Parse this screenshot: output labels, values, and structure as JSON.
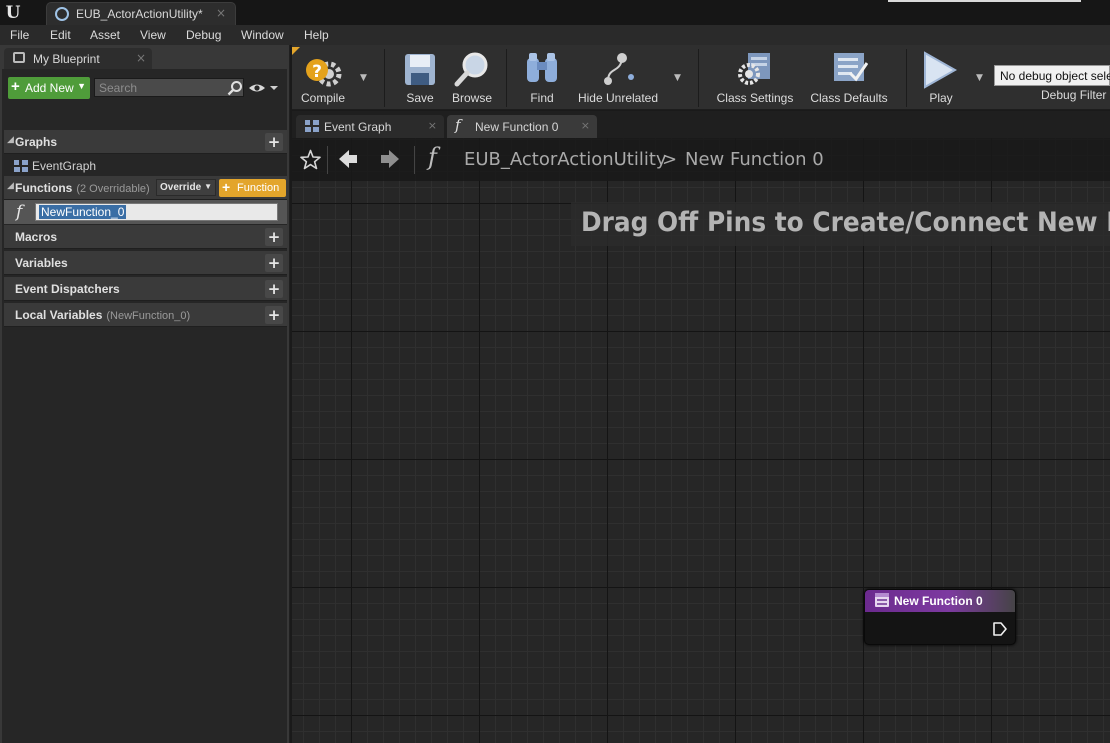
{
  "window": {
    "tab_title": "EUB_ActorActionUtility*",
    "tab_close": "×"
  },
  "menu": [
    "File",
    "Edit",
    "Asset",
    "View",
    "Debug",
    "Window",
    "Help"
  ],
  "left_panel": {
    "tab_label": "My Blueprint",
    "tab_close": "×",
    "add_new_label": "Add New",
    "search_placeholder": "Search",
    "sections": {
      "graphs": "Graphs",
      "graphs_item": "EventGraph",
      "functions": "Functions",
      "functions_sub": "(2 Overridable)",
      "override_label": "Override",
      "function_button_label": "Function",
      "function_item_name": "NewFunction_0",
      "macros": "Macros",
      "variables": "Variables",
      "event_dispatchers": "Event Dispatchers",
      "local_variables": "Local Variables",
      "local_variables_sub": "(NewFunction_0)"
    }
  },
  "toolbar": {
    "compile": "Compile",
    "save": "Save",
    "browse": "Browse",
    "find": "Find",
    "hide_unrelated": "Hide Unrelated",
    "class_settings": "Class Settings",
    "class_defaults": "Class Defaults",
    "play": "Play",
    "debug_object": "No debug object sele",
    "debug_filter": "Debug Filter"
  },
  "graph_tabs": [
    {
      "label": "Event Graph",
      "close": "×"
    },
    {
      "label": "New Function 0",
      "close": "×"
    }
  ],
  "graph": {
    "breadcrumb_blueprint": "EUB_ActorActionUtility",
    "breadcrumb_separator": ">",
    "breadcrumb_function": "New Function 0",
    "hint": "Drag Off Pins to Create/Connect New Nod",
    "node_title": "New Function 0"
  },
  "colors": {
    "add_new_green": "#4f9c3a",
    "function_orange": "#e3a52b",
    "node_purple": "#7d3aa0"
  }
}
